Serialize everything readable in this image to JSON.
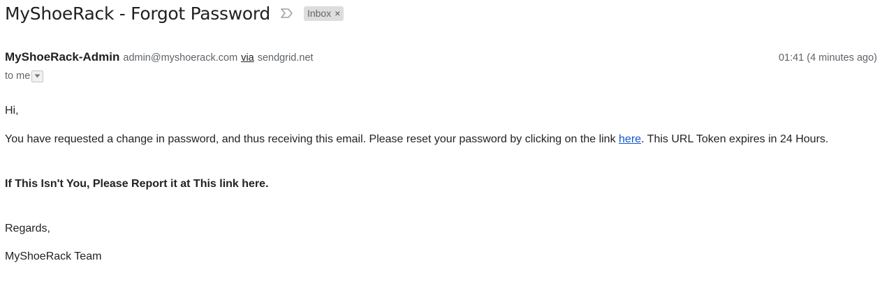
{
  "email": {
    "subject": "MyShoeRack - Forgot Password",
    "label": "Inbox",
    "label_remove_glyph": "×",
    "importance_icon": "importance-marker-icon",
    "sender": {
      "name": "MyShoeRack-Admin",
      "email": "admin@myshoerack.com",
      "via_label": "via",
      "via_domain": "sendgrid.net"
    },
    "timestamp": "01:41 (4 minutes ago)",
    "recipients": "to me",
    "recipients_toggle_icon": "dropdown-arrow-icon",
    "body": {
      "greeting": "Hi,",
      "paragraph_before_link": "You have requested a change in password, and thus receiving this email. Please reset your password by clicking on the link ",
      "link_text": "here",
      "paragraph_after_link": ". This URL Token expires in 24 Hours.",
      "report_line": "If This Isn't You, Please Report it at This link here.",
      "closing": "Regards,",
      "signature": "MyShoeRack Team"
    }
  },
  "colors": {
    "link": "#1155cc",
    "label_chip_bg": "#dddddd",
    "muted_text": "#5f6368",
    "body_text": "#222222"
  }
}
